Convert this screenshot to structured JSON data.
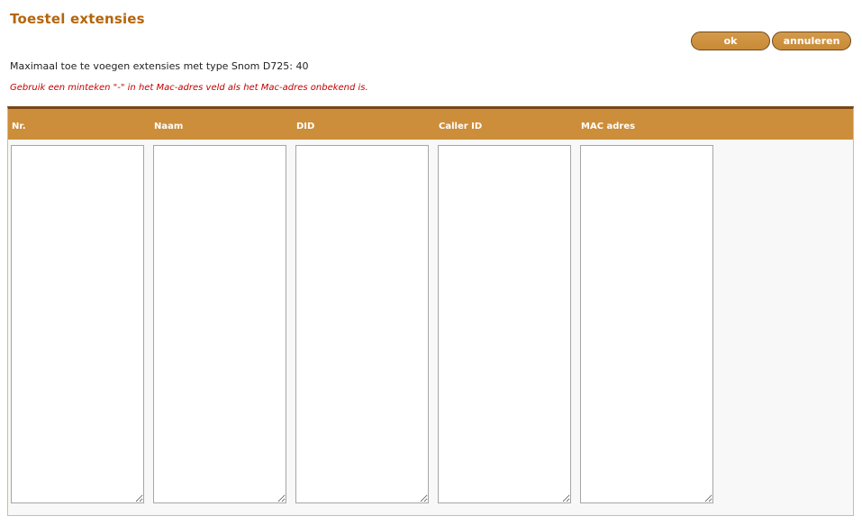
{
  "page": {
    "title": "Toestel extensies",
    "info_text": "Maximaal toe te voegen extensies met type Snom D725: 40",
    "hint_text": "Gebruik een minteken \"-\" in het Mac-adres veld als het Mac-adres onbekend is."
  },
  "buttons": {
    "ok_label": "ok",
    "cancel_label": "annuleren"
  },
  "table": {
    "columns": [
      {
        "label": "Nr.",
        "value": ""
      },
      {
        "label": "Naam",
        "value": ""
      },
      {
        "label": "DID",
        "value": ""
      },
      {
        "label": "Caller ID",
        "value": ""
      },
      {
        "label": "MAC adres",
        "value": ""
      }
    ]
  },
  "colors": {
    "title": "#b5650a",
    "header_bg": "#cc8e3a",
    "header_border": "#7a4416",
    "hint": "#c00000",
    "button_bg": "#c88b36"
  }
}
